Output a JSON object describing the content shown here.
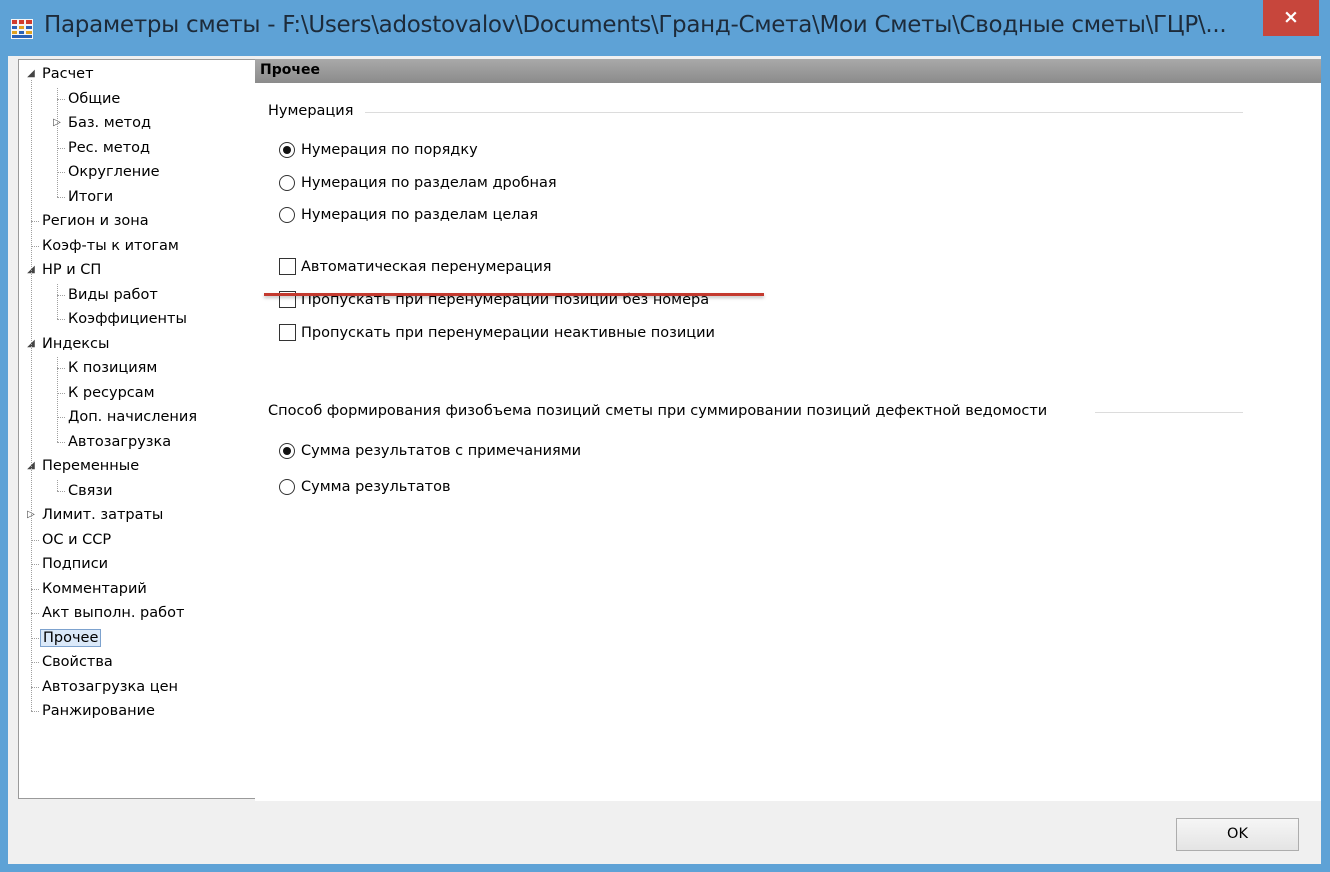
{
  "window": {
    "title": "Параметры сметы - F:\\Users\\adostovalov\\Documents\\Гранд-Смета\\Мои Сметы\\Сводные сметы\\ГЦР\\...",
    "close_label": "×",
    "titlebar_color": "#5ea2d6",
    "close_color": "#c7463c"
  },
  "tree": {
    "items": [
      {
        "label": "Расчет",
        "expander": "◢"
      },
      {
        "label": "Общие"
      },
      {
        "label": "Баз. метод",
        "expander": "▷"
      },
      {
        "label": "Рес. метод"
      },
      {
        "label": "Округление"
      },
      {
        "label": "Итоги"
      },
      {
        "label": "Регион и зона"
      },
      {
        "label": "Коэф-ты к итогам"
      },
      {
        "label": "НР и СП",
        "expander": "◢"
      },
      {
        "label": "Виды работ"
      },
      {
        "label": "Коэффициенты"
      },
      {
        "label": "Индексы",
        "expander": "◢"
      },
      {
        "label": "К позициям"
      },
      {
        "label": "К ресурсам"
      },
      {
        "label": "Доп. начисления"
      },
      {
        "label": "Автозагрузка"
      },
      {
        "label": "Переменные",
        "expander": "◢"
      },
      {
        "label": "Связи"
      },
      {
        "label": "Лимит. затраты",
        "expander": "▷"
      },
      {
        "label": "ОС и ССР"
      },
      {
        "label": "Подписи"
      },
      {
        "label": "Комментарий"
      },
      {
        "label": "Акт выполн. работ"
      },
      {
        "label": "Прочее",
        "selected": true
      },
      {
        "label": "Свойства"
      },
      {
        "label": "Автозагрузка цен"
      },
      {
        "label": "Ранжирование"
      }
    ]
  },
  "panel": {
    "title": "Прочее",
    "numbering": {
      "group_label": "Нумерация",
      "radios": [
        {
          "label": "Нумерация по порядку",
          "checked": true
        },
        {
          "label": "Нумерация по разделам дробная",
          "checked": false
        },
        {
          "label": "Нумерация по разделам целая",
          "checked": false
        }
      ],
      "checkboxes": [
        {
          "label": "Автоматическая перенумерация",
          "checked": false
        },
        {
          "label": "Пропускать при перенумерации позиции без номера",
          "checked": false
        },
        {
          "label": "Пропускать при перенумерации неактивные позиции",
          "checked": false
        }
      ]
    },
    "volume": {
      "group_label": "Способ формирования физобъема позиций сметы при суммировании позиций дефектной ведомости",
      "radios": [
        {
          "label": "Сумма результатов с примечаниями",
          "checked": true
        },
        {
          "label": "Сумма результатов",
          "checked": false
        }
      ]
    }
  },
  "footer": {
    "ok_label": "OK"
  }
}
